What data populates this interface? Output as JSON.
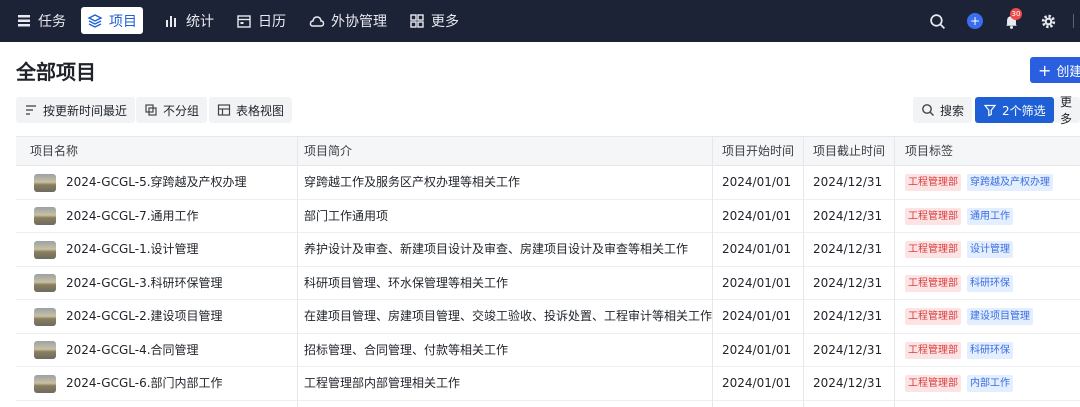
{
  "nav": {
    "items": [
      {
        "label": "任务",
        "icon": "tasks-icon"
      },
      {
        "label": "项目",
        "icon": "layers-icon",
        "active": true
      },
      {
        "label": "统计",
        "icon": "bar-chart-icon"
      },
      {
        "label": "日历",
        "icon": "calendar-icon"
      },
      {
        "label": "外协管理",
        "icon": "cloud-icon"
      },
      {
        "label": "更多",
        "icon": "grid-icon"
      }
    ],
    "notification_count": "30",
    "add_symbol": "+"
  },
  "page": {
    "title": "全部项目",
    "create_label": "创建"
  },
  "toolbar": {
    "sort_label": "按更新时间最近",
    "group_label": "不分组",
    "view_label": "表格视图",
    "search_label": "搜索",
    "filter_label": "2个筛选",
    "more_label": "更多"
  },
  "table": {
    "headers": [
      "项目名称",
      "项目简介",
      "项目开始时间",
      "项目截止时间",
      "项目标签"
    ],
    "rows": [
      {
        "name": "2024-GCGL-5.穿跨越及产权办理",
        "desc": "穿跨越工作及服务区产权办理等相关工作",
        "start": "2024/01/01",
        "end": "2024/12/31",
        "tags": [
          "工程管理部",
          "穿跨越及产权办理"
        ]
      },
      {
        "name": "2024-GCGL-7.通用工作",
        "desc": "部门工作通用项",
        "start": "2024/01/01",
        "end": "2024/12/31",
        "tags": [
          "工程管理部",
          "通用工作"
        ]
      },
      {
        "name": "2024-GCGL-1.设计管理",
        "desc": "养护设计及审查、新建项目设计及审查、房建项目设计及审查等相关工作",
        "start": "2024/01/01",
        "end": "2024/12/31",
        "tags": [
          "工程管理部",
          "设计管理"
        ]
      },
      {
        "name": "2024-GCGL-3.科研环保管理",
        "desc": "科研项目管理、环水保管理等相关工作",
        "start": "2024/01/01",
        "end": "2024/12/31",
        "tags": [
          "工程管理部",
          "科研环保"
        ]
      },
      {
        "name": "2024-GCGL-2.建设项目管理",
        "desc": "在建项目管理、房建项目管理、交竣工验收、投诉处置、工程审计等相关工作",
        "start": "2024/01/01",
        "end": "2024/12/31",
        "tags": [
          "工程管理部",
          "建设项目管理"
        ]
      },
      {
        "name": "2024-GCGL-4.合同管理",
        "desc": "招标管理、合同管理、付款等相关工作",
        "start": "2024/01/01",
        "end": "2024/12/31",
        "tags": [
          "工程管理部",
          "科研环保"
        ]
      },
      {
        "name": "2024-GCGL-6.部门内部工作",
        "desc": "工程管理部内部管理相关工作",
        "start": "2024/01/01",
        "end": "2024/12/31",
        "tags": [
          "工程管理部",
          "内部工作"
        ]
      }
    ]
  },
  "colors": {
    "nav_bg": "#1d2336",
    "accent": "#1f5fd6",
    "tag_red": "#d93d3d",
    "tag_blue": "#3a6de0"
  }
}
